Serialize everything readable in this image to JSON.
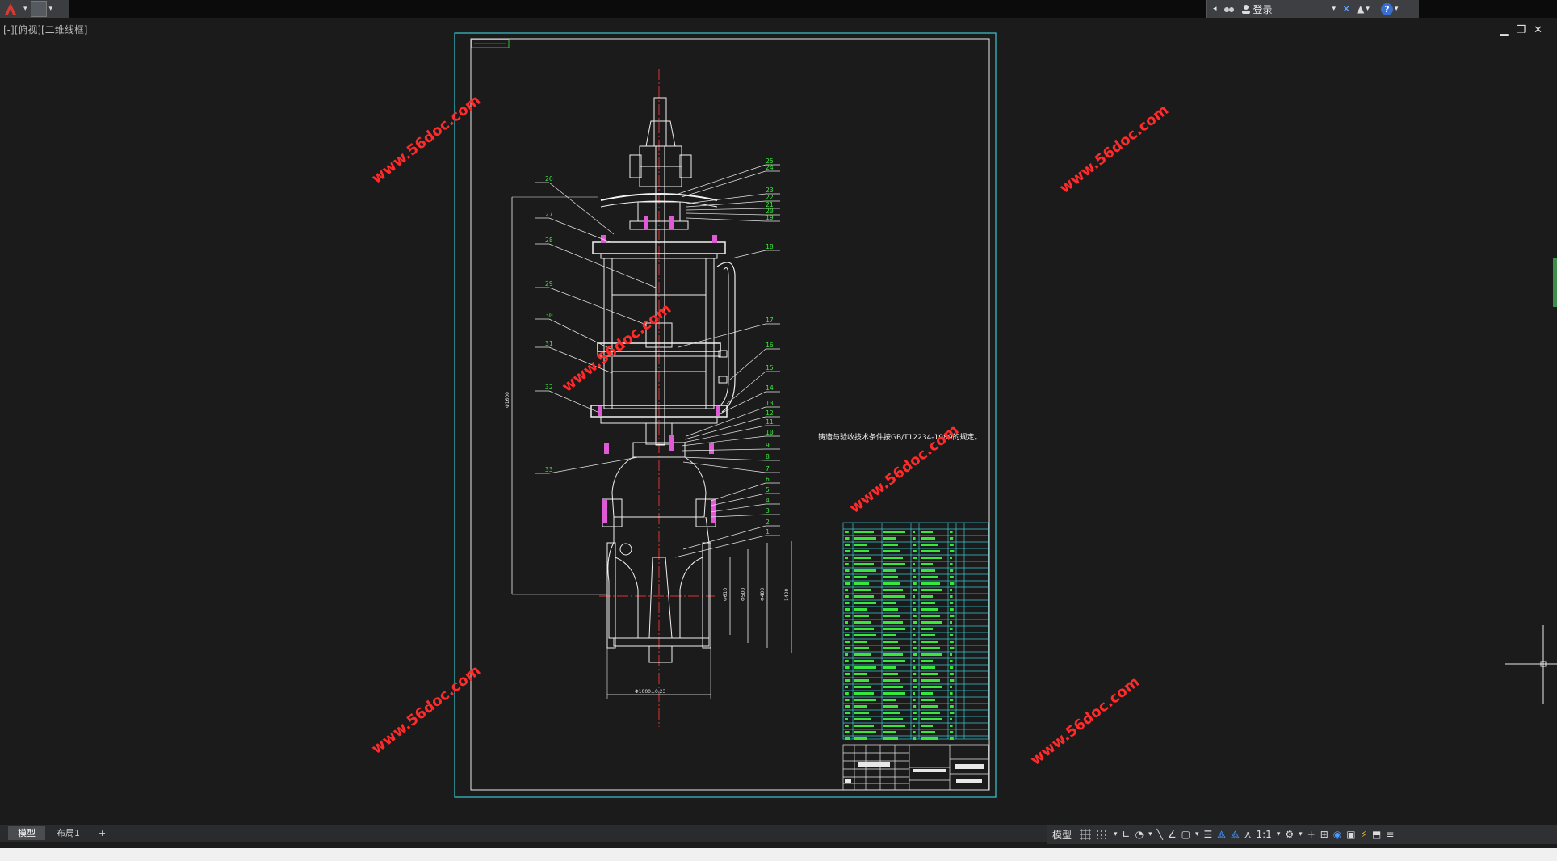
{
  "app": {
    "view_label": "[-][俯视][二维线框]",
    "login_label": "登录"
  },
  "drawing": {
    "title_note": "铸造与验收技术条件按GB/T12234-1989的规定。",
    "watermark": "www.56doc.com",
    "part_numbers_right": [
      "25",
      "24",
      "23",
      "22",
      "21",
      "20",
      "19",
      "18",
      "17",
      "16",
      "15",
      "14",
      "13",
      "12",
      "11",
      "10",
      "9",
      "8",
      "7",
      "6",
      "5",
      "4",
      "3",
      "2",
      "1"
    ],
    "part_numbers_left": [
      "26",
      "27",
      "28",
      "29",
      "30",
      "31",
      "32",
      "33"
    ],
    "dim_labels": [
      "Φ610",
      "Φ500",
      "Φ400",
      "Φ1000±0.23",
      "Φ1600",
      "1400"
    ]
  },
  "tabs": {
    "model": "模型",
    "layout1": "布局1",
    "add": "+"
  },
  "status": {
    "model": "模型",
    "scale": "1:1"
  },
  "colors": {
    "accent_cyan": "#39c8d0",
    "drawing_white": "#f2f2f2",
    "part_green": "#39e639",
    "centerline_red": "#e03030",
    "watermark_red": "#ff2a2a",
    "background": "#1b1b1c"
  }
}
